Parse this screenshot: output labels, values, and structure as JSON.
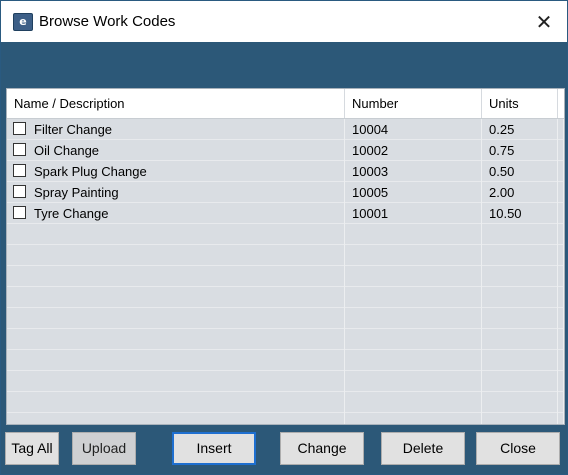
{
  "window": {
    "title": "Browse Work Codes",
    "app_icon": "e-app-icon",
    "app_icon_letter": "e",
    "close_glyph": "✕"
  },
  "grid": {
    "columns": [
      "Name / Description",
      "Number",
      "Units"
    ],
    "rows": [
      {
        "name": "Filter Change",
        "number": "10004",
        "units": "0.25",
        "checked": false
      },
      {
        "name": "Oil Change",
        "number": "10002",
        "units": "0.75",
        "checked": false
      },
      {
        "name": "Spark Plug Change",
        "number": "10003",
        "units": "0.50",
        "checked": false
      },
      {
        "name": "Spray Painting",
        "number": "10005",
        "units": "2.00",
        "checked": false
      },
      {
        "name": "Tyre Change",
        "number": "10001",
        "units": "10.50",
        "checked": false
      }
    ]
  },
  "buttons": {
    "tag_all": "Tag All",
    "upload": "Upload",
    "insert": "Insert",
    "change": "Change",
    "delete": "Delete",
    "close": "Close"
  },
  "colors": {
    "window_frame": "#2c5878",
    "grid_background": "#d9dde2",
    "button_focus": "#1e6fd0"
  }
}
